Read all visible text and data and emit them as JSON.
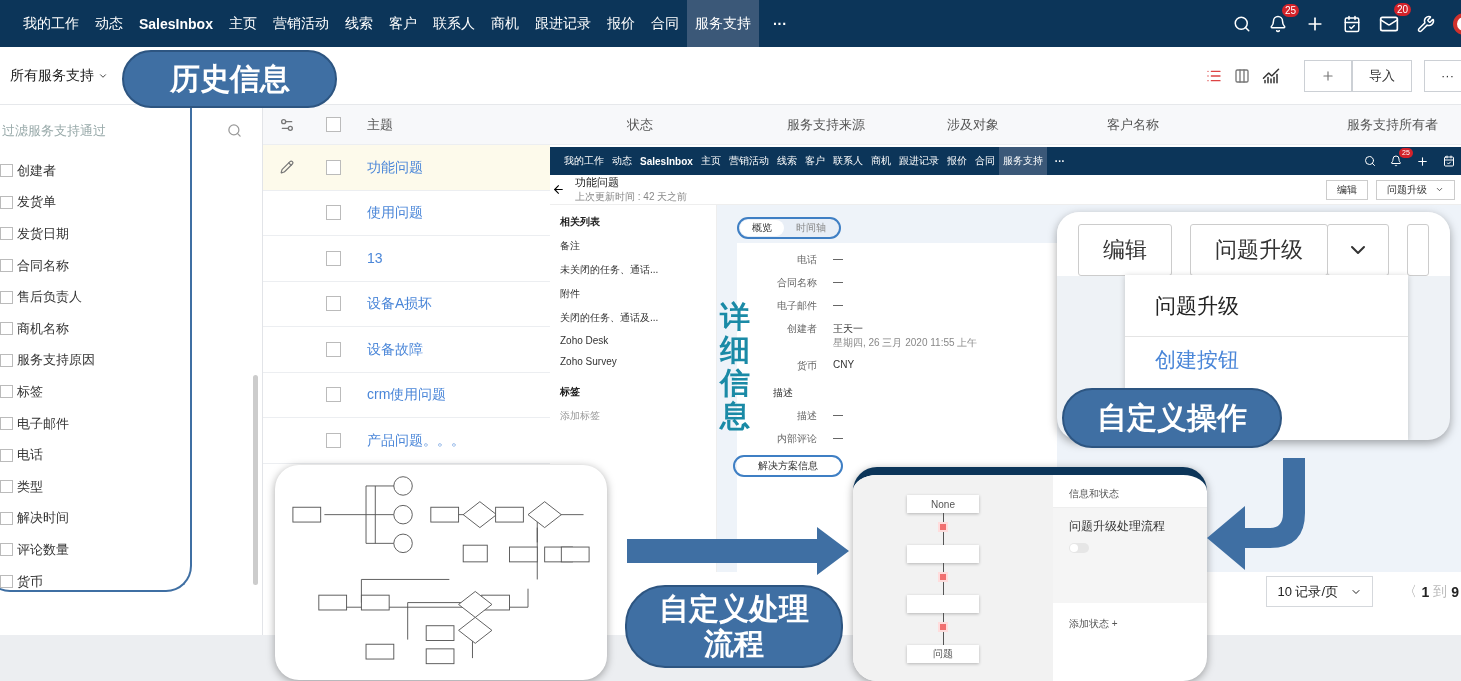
{
  "top_nav": {
    "items": [
      {
        "label": "我的工作",
        "selected": false
      },
      {
        "label": "动态",
        "selected": false
      },
      {
        "label": "SalesInbox",
        "selected": false
      },
      {
        "label": "主页",
        "selected": false
      },
      {
        "label": "营销活动",
        "selected": false
      },
      {
        "label": "线索",
        "selected": false
      },
      {
        "label": "客户",
        "selected": false
      },
      {
        "label": "联系人",
        "selected": false
      },
      {
        "label": "商机",
        "selected": false
      },
      {
        "label": "跟进记录",
        "selected": false
      },
      {
        "label": "报价",
        "selected": false
      },
      {
        "label": "合同",
        "selected": false
      },
      {
        "label": "服务支持",
        "selected": true
      }
    ],
    "more": "···",
    "bell_badge": "25",
    "mail_badge": "20"
  },
  "toolbar": {
    "view_select": "所有服务支持",
    "import": "导入",
    "more": "···"
  },
  "filter": {
    "placeholder": "过滤服务支持通过",
    "fields": [
      {
        "label": "创建者",
        "checked": false
      },
      {
        "label": "发货单",
        "checked": false
      },
      {
        "label": "发货日期",
        "checked": false
      },
      {
        "label": "合同名称",
        "checked": false
      },
      {
        "label": "售后负责人",
        "checked": false
      },
      {
        "label": "商机名称",
        "checked": false
      },
      {
        "label": "服务支持原因",
        "checked": false
      },
      {
        "label": "标签",
        "checked": false
      },
      {
        "label": "电子邮件",
        "checked": false
      },
      {
        "label": "电话",
        "checked": false
      },
      {
        "label": "类型",
        "checked": false
      },
      {
        "label": "解决时间",
        "checked": false
      },
      {
        "label": "评论数量",
        "checked": false
      },
      {
        "label": "货币",
        "checked": false
      }
    ]
  },
  "table": {
    "all_checked": false,
    "columns": [
      "主题",
      "状态",
      "服务支持来源",
      "涉及对象",
      "客户名称",
      "服务支持所有者"
    ],
    "rows": [
      {
        "subject": "功能问题",
        "selected": true,
        "checked": false
      },
      {
        "subject": "使用问题",
        "selected": false,
        "checked": false
      },
      {
        "subject": "13",
        "selected": false,
        "checked": false
      },
      {
        "subject": "设备A损坏",
        "selected": false,
        "checked": false
      },
      {
        "subject": "设备故障",
        "selected": false,
        "checked": false
      },
      {
        "subject": "crm使用问题",
        "selected": false,
        "checked": false
      },
      {
        "subject": "产品问题。。。",
        "selected": false,
        "checked": false
      }
    ]
  },
  "pagination": {
    "per_page": "10 记录/页",
    "prev": "〈",
    "page": "1",
    "to": "到",
    "total": "9"
  },
  "detail_inset": {
    "nav_items": [
      {
        "label": "我的工作",
        "selected": false
      },
      {
        "label": "动态",
        "selected": false
      },
      {
        "label": "SalesInbox",
        "selected": false
      },
      {
        "label": "主页",
        "selected": false
      },
      {
        "label": "营销活动",
        "selected": false
      },
      {
        "label": "线索",
        "selected": false
      },
      {
        "label": "客户",
        "selected": false
      },
      {
        "label": "联系人",
        "selected": false
      },
      {
        "label": "商机",
        "selected": false
      },
      {
        "label": "跟进记录",
        "selected": false
      },
      {
        "label": "报价",
        "selected": false
      },
      {
        "label": "合同",
        "selected": false
      },
      {
        "label": "服务支持",
        "selected": true
      }
    ],
    "more": "···",
    "bell_badge": "25",
    "title": "功能问题",
    "subtitle": "上次更新时间 : 42 天之前",
    "buttons": [
      "编辑",
      "问题升级"
    ],
    "related_title": "相关列表",
    "related": [
      "备注",
      "未关闭的任务、通话...",
      "附件",
      "关闭的任务、通话及...",
      "Zoho Desk",
      "Zoho Survey"
    ],
    "tags_title": "标签",
    "add_tag": "添加标签",
    "tabs": [
      {
        "label": "概览",
        "selected": true
      },
      {
        "label": "时间轴",
        "selected": false
      }
    ],
    "fields": [
      {
        "label": "电话",
        "value": "—"
      },
      {
        "label": "合同名称",
        "value": "—"
      },
      {
        "label": "电子邮件",
        "value": "—"
      },
      {
        "label": "创建者",
        "value": "王天一",
        "sub": "星期四, 26 三月 2020 11:55 上午"
      },
      {
        "label": "货币",
        "value": "CNY"
      }
    ],
    "section": "描述",
    "section_fields": [
      {
        "label": "描述",
        "value": "—"
      },
      {
        "label": "内部评论",
        "value": "—"
      }
    ],
    "solution": "解决方案信息"
  },
  "actions_inset": {
    "buttons": [
      "编辑",
      "问题升级"
    ],
    "menu": [
      {
        "label": "问题升级",
        "kind": "item"
      },
      {
        "label": "创建按钮",
        "kind": "link"
      }
    ]
  },
  "workflow_inset": {
    "nodes": [
      {
        "kind": "state",
        "label": "None"
      },
      {
        "kind": "state"
      },
      {
        "kind": "state"
      },
      {
        "kind": "state",
        "label": "问题"
      }
    ],
    "tab": "信息和状态",
    "title": "问题升级处理流程",
    "toggle": {
      "on": false
    },
    "add_state": "添加状态 +"
  },
  "callouts": {
    "history": "历史信息",
    "detail": "详细信息",
    "actions": "自定义操作",
    "process": [
      "自定义处理",
      "流程"
    ]
  }
}
